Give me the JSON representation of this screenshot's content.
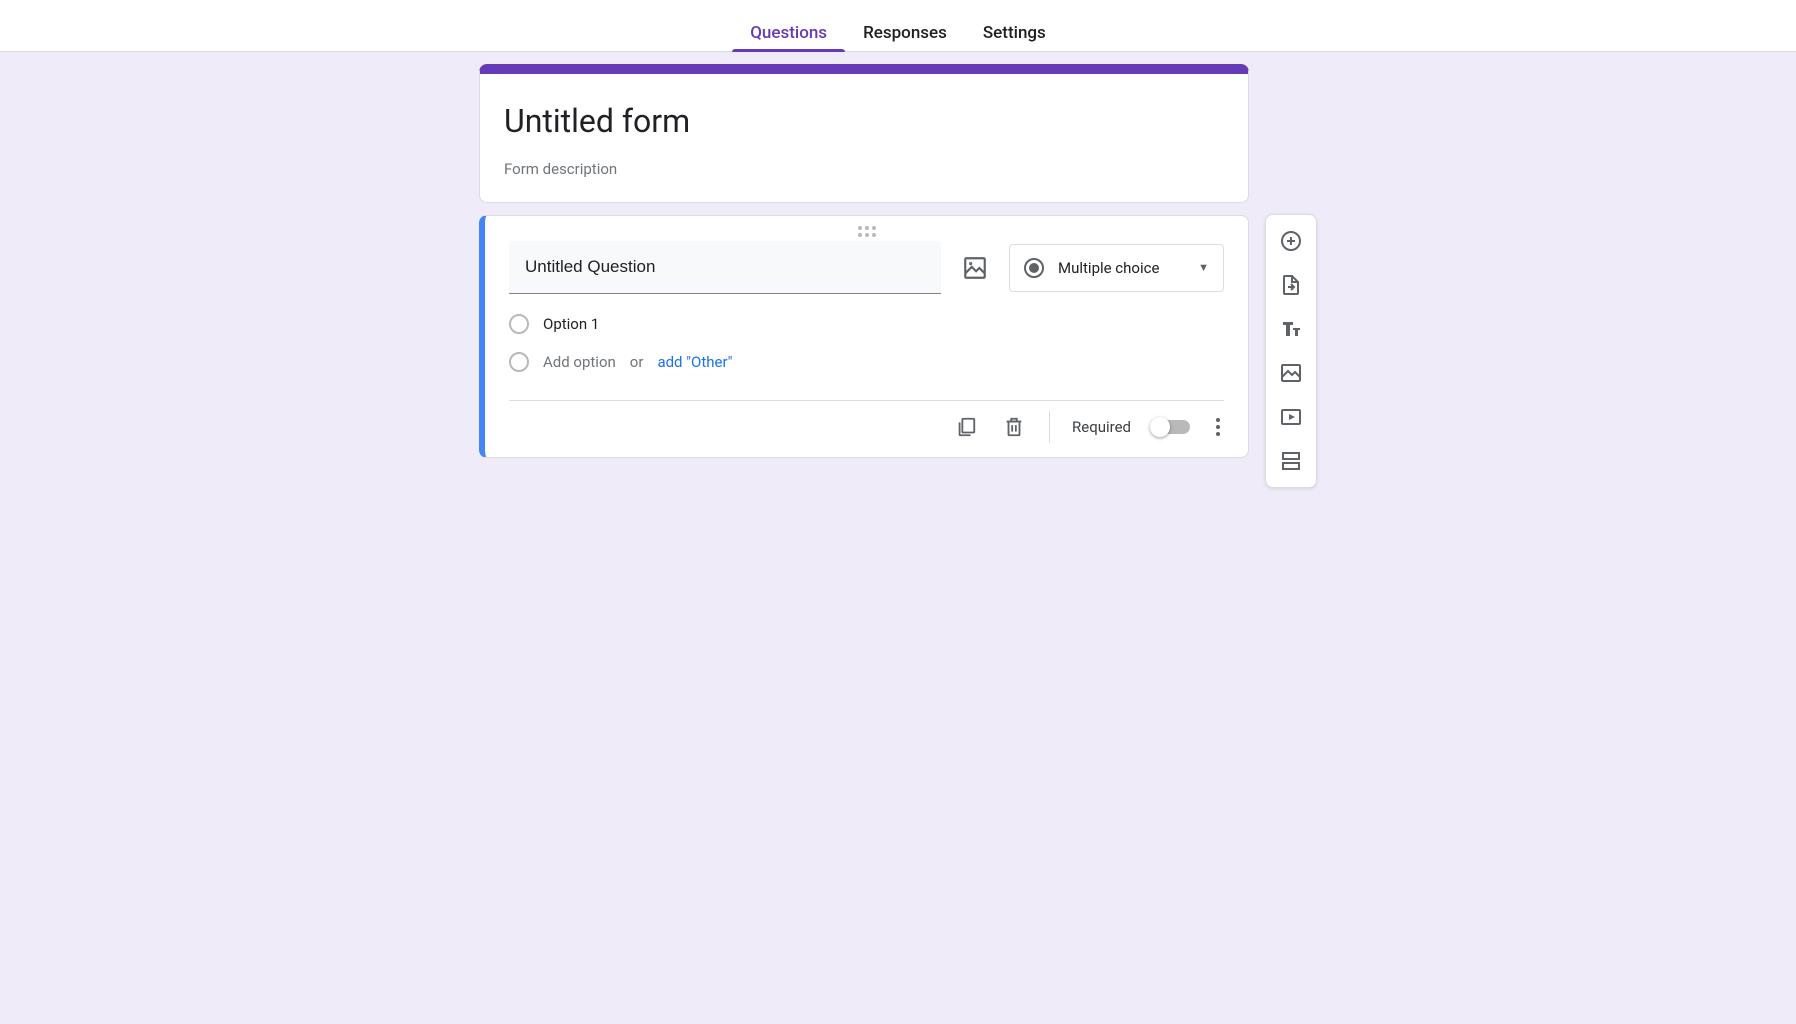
{
  "tabs": {
    "questions": "Questions",
    "responses": "Responses",
    "settings": "Settings"
  },
  "form_header": {
    "title": "Untitled form",
    "description_placeholder": "Form description"
  },
  "question": {
    "title": "Untitled Question",
    "type_label": "Multiple choice",
    "options": {
      "opt1": "Option 1",
      "add_option": "Add option",
      "or": "or",
      "add_other": "add \"Other\""
    },
    "footer": {
      "required_label": "Required",
      "required_on": false
    }
  }
}
